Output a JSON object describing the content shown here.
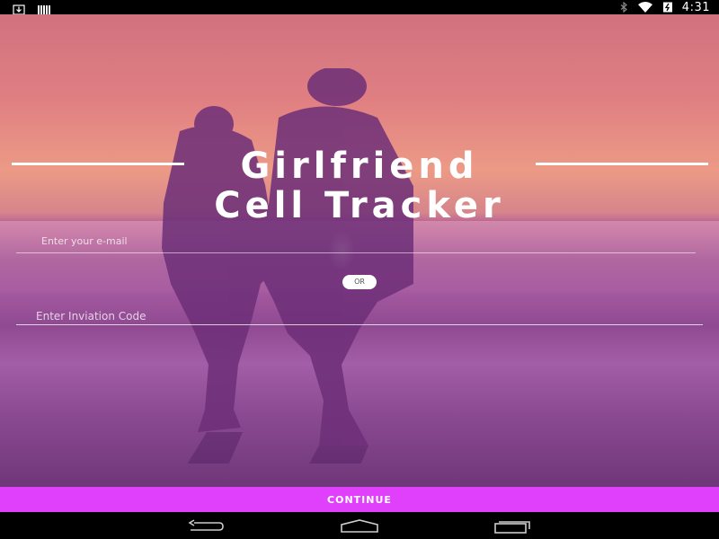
{
  "status_bar": {
    "time": "4:31",
    "icons": [
      "download-icon",
      "barcode-icon",
      "bluetooth-icon",
      "wifi-icon",
      "battery-charging-icon"
    ]
  },
  "title": {
    "line1": "Girlfriend",
    "line2": "Cell Tracker"
  },
  "form": {
    "email_placeholder": "Enter your e-mail",
    "email_value": "",
    "or_label": "OR",
    "code_placeholder": "Enter Inviation Code",
    "code_value": ""
  },
  "continue_label": "CONTINUE",
  "nav_bar": {
    "icons": [
      "back-icon",
      "home-icon",
      "recent-apps-icon"
    ]
  },
  "colors": {
    "accent": "#e040fb",
    "status_bar": "#000000",
    "nav_bar": "#000000"
  }
}
